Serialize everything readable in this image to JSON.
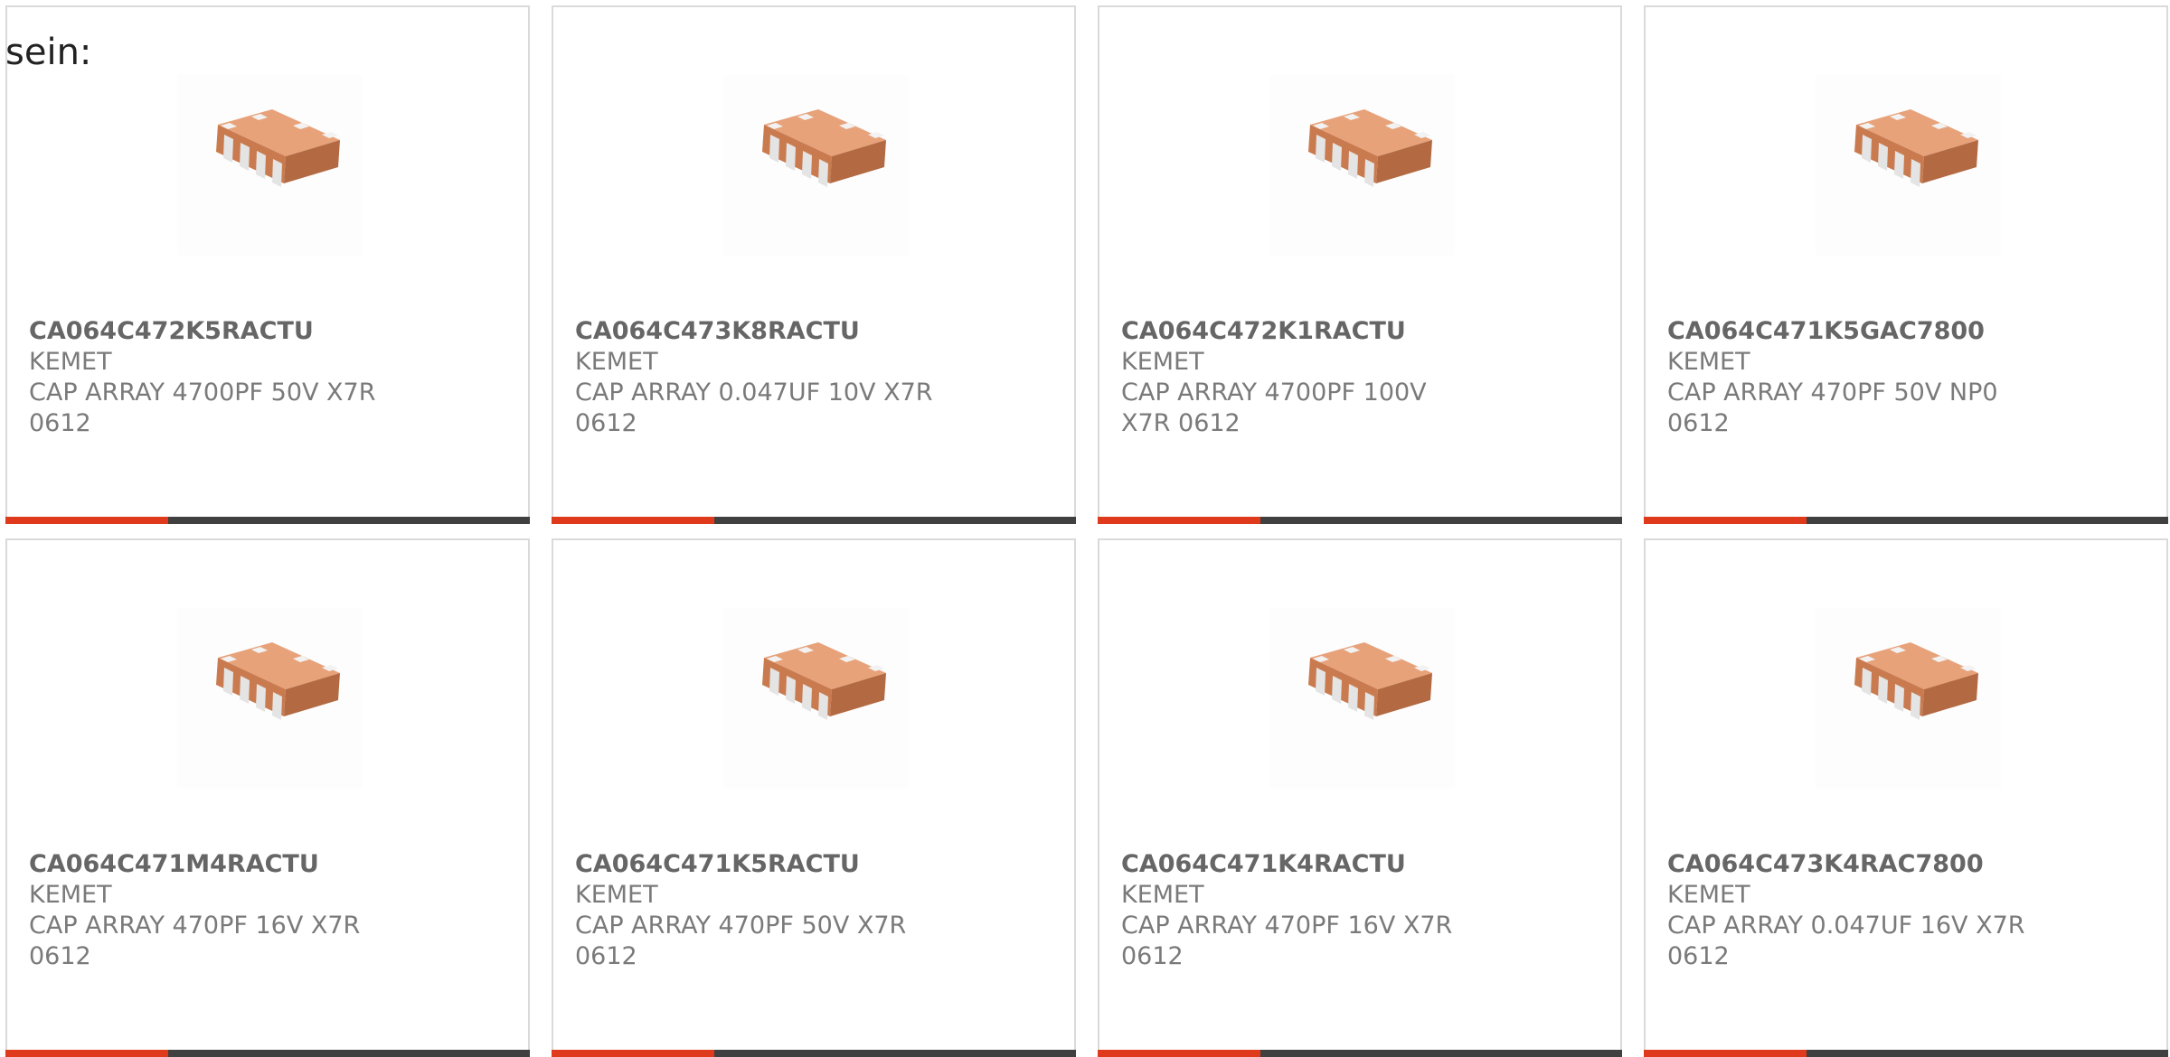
{
  "intro_text": "sein:",
  "colors": {
    "accent": "#e03a1c",
    "bar_track": "#404040",
    "card_border": "#dadada",
    "title_text": "#666666",
    "body_text": "#7a7a7a"
  },
  "products": [
    {
      "part": "CA064C472K5RACTU",
      "maker": "KEMET",
      "description": "CAP ARRAY 4700PF 50V X7R 0612",
      "image_icon": "capacitor-array-chip-icon",
      "bar_fill": 0.31
    },
    {
      "part": "CA064C473K8RACTU",
      "maker": "KEMET",
      "description": "CAP ARRAY 0.047UF 10V X7R 0612",
      "image_icon": "capacitor-array-chip-icon",
      "bar_fill": 0.31
    },
    {
      "part": "CA064C472K1RACTU",
      "maker": "KEMET",
      "description": "CAP ARRAY 4700PF 100V X7R 0612",
      "image_icon": "capacitor-array-chip-icon",
      "bar_fill": 0.31
    },
    {
      "part": "CA064C471K5GAC7800",
      "maker": "KEMET",
      "description": "CAP ARRAY 470PF 50V NP0 0612",
      "image_icon": "capacitor-array-chip-icon",
      "bar_fill": 0.31
    },
    {
      "part": "CA064C471M4RACTU",
      "maker": "KEMET",
      "description": "CAP ARRAY 470PF 16V X7R 0612",
      "image_icon": "capacitor-array-chip-icon",
      "bar_fill": 0.31
    },
    {
      "part": "CA064C471K5RACTU",
      "maker": "KEMET",
      "description": "CAP ARRAY 470PF 50V X7R 0612",
      "image_icon": "capacitor-array-chip-icon",
      "bar_fill": 0.31
    },
    {
      "part": "CA064C471K4RACTU",
      "maker": "KEMET",
      "description": "CAP ARRAY 470PF 16V X7R 0612",
      "image_icon": "capacitor-array-chip-icon",
      "bar_fill": 0.31
    },
    {
      "part": "CA064C473K4RAC7800",
      "maker": "KEMET",
      "description": "CAP ARRAY 0.047UF 16V X7R 0612",
      "image_icon": "capacitor-array-chip-icon",
      "bar_fill": 0.31
    }
  ]
}
